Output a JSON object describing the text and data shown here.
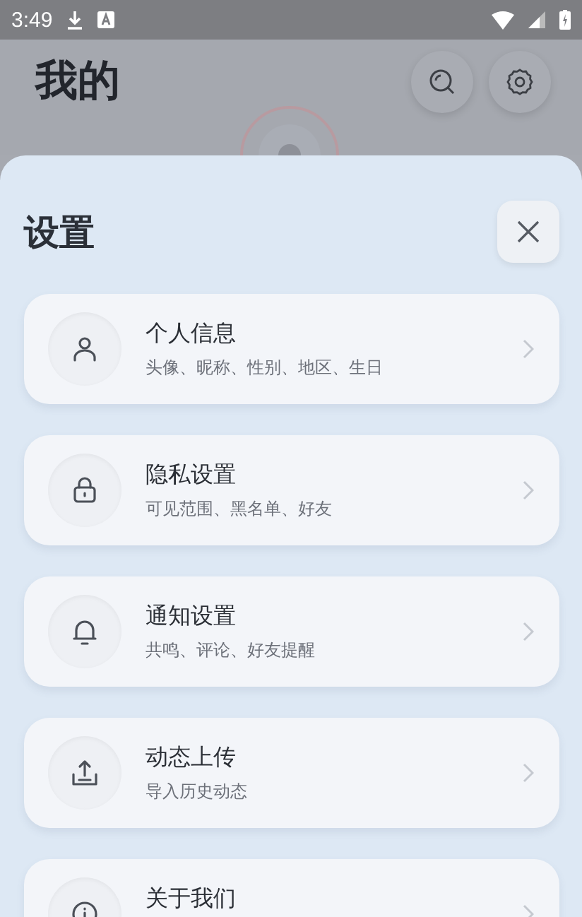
{
  "status_bar": {
    "time": "3:49"
  },
  "page": {
    "title": "我的"
  },
  "sheet": {
    "title": "设置",
    "items": [
      {
        "kind": "person",
        "title": "个人信息",
        "subtitle": "头像、昵称、性别、地区、生日"
      },
      {
        "kind": "lock",
        "title": "隐私设置",
        "subtitle": "可见范围、黑名单、好友"
      },
      {
        "kind": "bell",
        "title": "通知设置",
        "subtitle": "共鸣、评论、好友提醒"
      },
      {
        "kind": "upload",
        "title": "动态上传",
        "subtitle": "导入历史动态"
      },
      {
        "kind": "info",
        "title": "关于我们"
      }
    ]
  }
}
